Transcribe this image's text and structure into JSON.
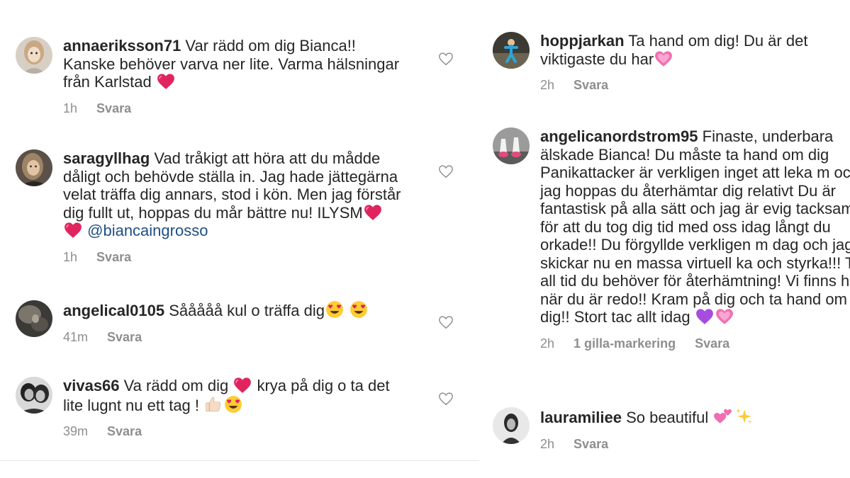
{
  "left": {
    "comments": [
      {
        "user": "annaeriksson71",
        "text_1": " Var rädd om dig Bianca!! Kanske behöver varva ner lite. Varma hälsningar från Karlstad ",
        "time": "1h",
        "reply": "Svara"
      },
      {
        "user": "saragyllhag",
        "text_1": " Vad tråkigt att höra att du mådde dåligt och behövde ställa in. Jag hade jättegärna velat träffa dig annars, stod i kön. Men jag förstår dig fullt ut, hoppas du mår bättre nu! ILYSM",
        "text_2": " ",
        "mention": "@biancaingrosso",
        "time": "1h",
        "reply": "Svara"
      },
      {
        "user": "angelical0105",
        "text_1": " Sååååå kul o träffa dig",
        "time": "41m",
        "reply": "Svara"
      },
      {
        "user": "vivas66",
        "text_1": " Va rädd om dig ",
        "text_2": " krya på dig o ta det lite lugnt nu ett tag ! ",
        "time": "39m",
        "reply": "Svara"
      }
    ]
  },
  "right": {
    "comments": [
      {
        "user": "hoppjarkan",
        "text_1": " Ta hand om dig! Du är det viktigaste du har",
        "time": "2h",
        "reply": "Svara"
      },
      {
        "user": "angelicanordstrom95",
        "text_1": " Finaste, underbara älskade Bianca! Du måste ta hand om dig Panikattacker är verkligen inget att leka m och jag hoppas du återhämtar dig relativt Du är fantastisk på alla sätt och jag är evig tacksam för att du tog dig tid med oss idag långt du orkade!! Du förgyllde verkligen m dag och jag skickar nu en massa virtuell ka och styrka!!! Ta all tid du behöver för återhämtning! Vi finns här när du är redo!! Kram på dig och ta hand om dig!! Stort tac allt idag ",
        "time": "2h",
        "likes": "1 gilla-markering",
        "reply": "Svara"
      },
      {
        "user": "lauramiliee",
        "text_1": " So beautiful ",
        "time": "2h",
        "reply": "Svara"
      }
    ]
  },
  "icons": {
    "like": "heart-outline-icon",
    "red_heart": "red-heart-emoji",
    "pink_heart": "sparkling-pink-heart-emoji",
    "purple_heart": "purple-heart-emoji",
    "heart_eyes": "heart-eyes-emoji",
    "thumbs_up": "thumbs-up-emoji",
    "two_hearts": "two-hearts-emoji",
    "sparkles": "sparkles-emoji"
  },
  "colors": {
    "text": "#262626",
    "meta": "#8e8e8e",
    "mention": "#1f4f86",
    "heart_red": "#e0245e"
  }
}
